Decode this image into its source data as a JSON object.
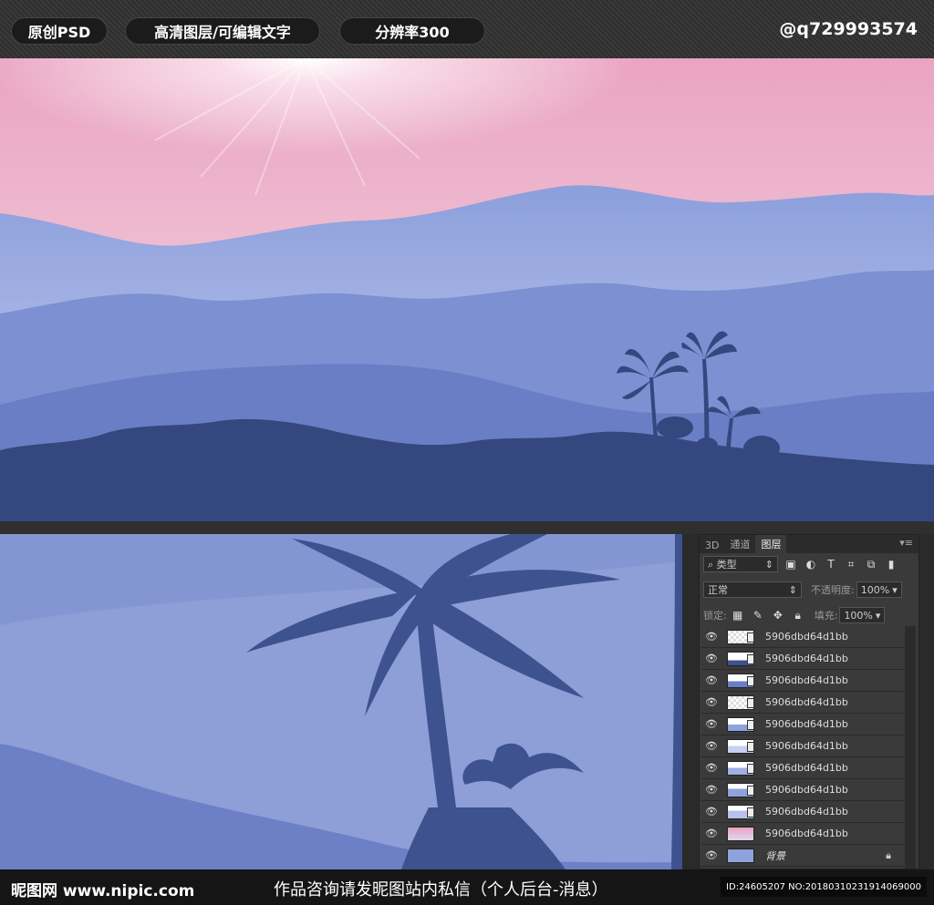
{
  "header": {
    "badges": [
      "原创PSD",
      "高清图层/可编辑文字",
      "分辨率300"
    ],
    "handle": "@q729993574"
  },
  "layers_panel": {
    "tabs": [
      "3D",
      "通道",
      "图层"
    ],
    "active_tab": "图层",
    "menu_icon": "panel-menu-icon",
    "filter_kind": "类型",
    "blend_mode": "正常",
    "opacity_label": "不透明度:",
    "opacity_value": "100%",
    "lock_label": "锁定:",
    "fill_label": "填充:",
    "fill_value": "100%",
    "layers": [
      {
        "name": "5906dbd64d1bb"
      },
      {
        "name": "5906dbd64d1bb"
      },
      {
        "name": "5906dbd64d1bb"
      },
      {
        "name": "5906dbd64d1bb"
      },
      {
        "name": "5906dbd64d1bb"
      },
      {
        "name": "5906dbd64d1bb"
      },
      {
        "name": "5906dbd64d1bb"
      },
      {
        "name": "5906dbd64d1bb"
      },
      {
        "name": "5906dbd64d1bb"
      },
      {
        "name": "5906dbd64d1bb"
      },
      {
        "name": "背景",
        "locked": true
      }
    ]
  },
  "footer": {
    "logo": "昵图网 www.nipic.com",
    "notice": "作品咨询请发昵图站内私信（个人后台-消息）",
    "id_text": "ID:24605207 NO:20180310231914069000"
  },
  "colors": {
    "sky_top": "#e7a6c4",
    "mountain_far": "#8ea3dc",
    "mountain_mid": "#6f84c8",
    "silhouette": "#34487f"
  }
}
